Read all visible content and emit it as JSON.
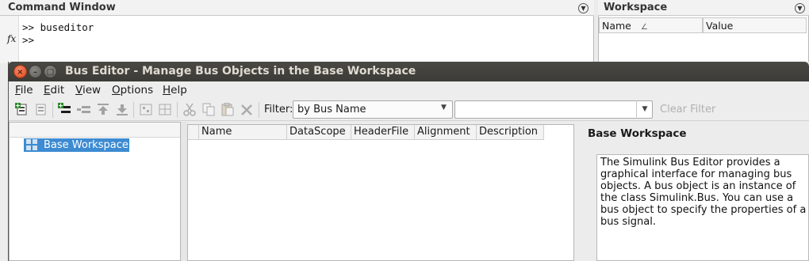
{
  "command_window": {
    "title": "Command Window",
    "fx_symbol": "fx",
    "lines": [
      ">> buseditor",
      ">>"
    ]
  },
  "workspace": {
    "title": "Workspace",
    "columns": [
      "Name",
      "Value"
    ],
    "sort_indicator": "∠"
  },
  "bus_editor": {
    "window_title": "Bus Editor - Manage Bus Objects in the Base Workspace",
    "window_buttons": {
      "close": "×",
      "minimize": "–",
      "maximize": "□"
    },
    "menu": [
      {
        "label": "File",
        "mnemonic": "F",
        "rest": "ile"
      },
      {
        "label": "Edit",
        "mnemonic": "E",
        "rest": "dit"
      },
      {
        "label": "View",
        "mnemonic": "V",
        "rest": "iew"
      },
      {
        "label": "Options",
        "mnemonic": "O",
        "rest": "ptions"
      },
      {
        "label": "Help",
        "mnemonic": "H",
        "rest": "elp"
      }
    ],
    "toolbar": {
      "filter_label": "Filter:",
      "filter_mode": "by Bus Name",
      "filter_text": "",
      "clear_filter": "Clear Filter"
    },
    "tree": {
      "selected_item": "Base Workspace"
    },
    "table": {
      "columns": [
        "Name",
        "DataScope",
        "HeaderFile",
        "Alignment",
        "Description"
      ],
      "rows": []
    },
    "info": {
      "title": "Base Workspace",
      "description": "The Simulink Bus Editor provides a graphical interface for managing bus objects. A bus object is an instance of the class Simulink.Bus. You can use a bus object to specify the properties of a bus signal."
    }
  },
  "colors": {
    "titlebar": "#3c3b37",
    "close_button": "#df4a1b",
    "selection": "#3d8bd2",
    "disabled_text": "#b0b0b0"
  }
}
